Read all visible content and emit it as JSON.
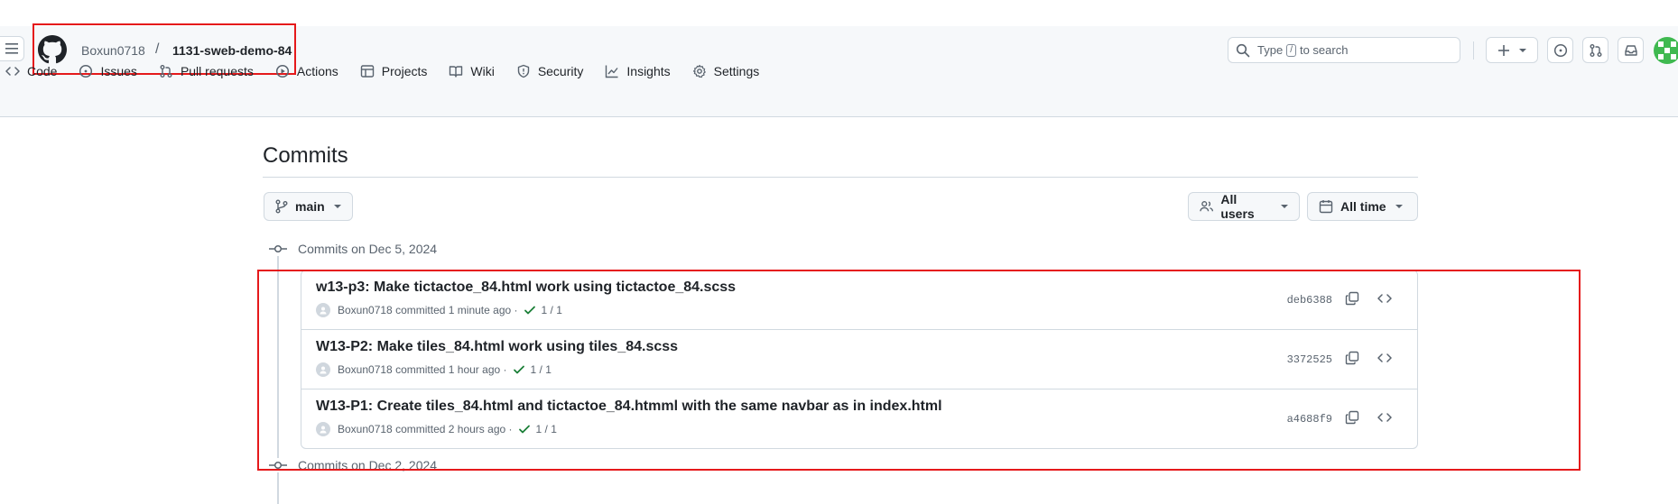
{
  "header": {
    "owner": "Boxun0718",
    "separator": "/",
    "repo": "1131-sweb-demo-84",
    "search_prefix": "Type",
    "search_key": "/",
    "search_suffix": "to search"
  },
  "nav": [
    {
      "label": "Code",
      "icon": "code-icon"
    },
    {
      "label": "Issues",
      "icon": "issue-icon"
    },
    {
      "label": "Pull requests",
      "icon": "pull-request-icon"
    },
    {
      "label": "Actions",
      "icon": "play-icon"
    },
    {
      "label": "Projects",
      "icon": "table-icon"
    },
    {
      "label": "Wiki",
      "icon": "book-icon"
    },
    {
      "label": "Security",
      "icon": "shield-icon"
    },
    {
      "label": "Insights",
      "icon": "graph-icon"
    },
    {
      "label": "Settings",
      "icon": "gear-icon"
    }
  ],
  "page": {
    "title": "Commits",
    "branch": "main",
    "users_filter": "All users",
    "time_filter": "All time"
  },
  "groups": [
    {
      "heading": "Commits on Dec 5, 2024"
    },
    {
      "heading": "Commits on Dec 2, 2024"
    }
  ],
  "commits": [
    {
      "message": "w13-p3: Make tictactoe_84.html work using tictactoe_84.scss",
      "author": "Boxun0718",
      "action": "committed",
      "time": "1 minute ago",
      "checks": "1 / 1",
      "sha": "deb6388"
    },
    {
      "message": "W13-P2: Make tiles_84.html work using tiles_84.scss",
      "author": "Boxun0718",
      "action": "committed",
      "time": "1 hour ago",
      "checks": "1 / 1",
      "sha": "3372525"
    },
    {
      "message": "W13-P1: Create tiles_84.html and tictactoe_84.htmml with the same navbar as in index.html",
      "author": "Boxun0718",
      "action": "committed",
      "time": "2 hours ago",
      "checks": "1 / 1",
      "sha": "a4688f9"
    }
  ],
  "colors": {
    "highlight": "#e5191b",
    "success": "#1a7f37",
    "avatar": "#3fb950"
  }
}
